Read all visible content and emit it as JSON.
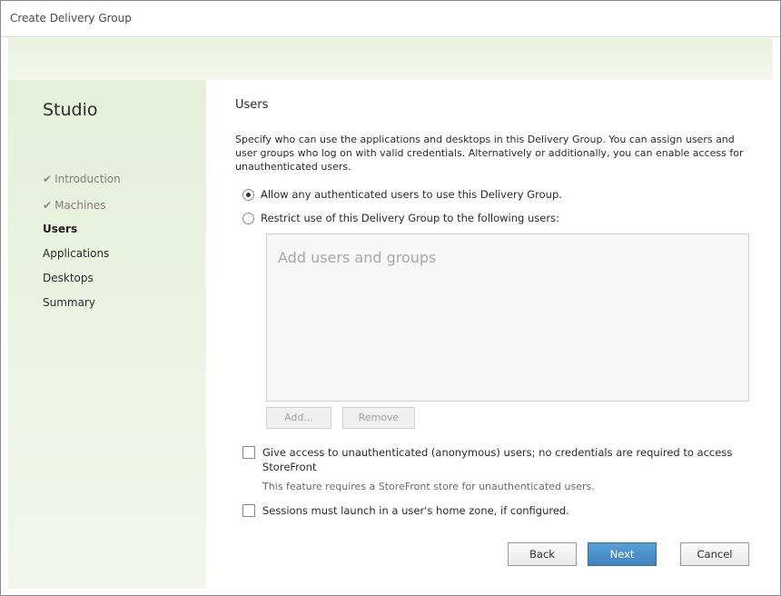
{
  "window": {
    "title": "Create Delivery Group"
  },
  "sidebar": {
    "brand": "Studio",
    "steps": [
      {
        "label": "Introduction",
        "state": "done"
      },
      {
        "label": "Machines",
        "state": "done"
      },
      {
        "label": "Users",
        "state": "active"
      },
      {
        "label": "Applications",
        "state": "pending"
      },
      {
        "label": "Desktops",
        "state": "pending"
      },
      {
        "label": "Summary",
        "state": "pending"
      }
    ]
  },
  "main": {
    "section_title": "Users",
    "description": "Specify who can use the applications and desktops in this Delivery Group. You can assign users and user groups who log on with valid credentials. Alternatively or additionally, you can enable access for unauthenticated users.",
    "radio_options": [
      {
        "label": "Allow any authenticated users to use this Delivery Group.",
        "selected": true
      },
      {
        "label": "Restrict use of this Delivery Group to the following users:",
        "selected": false
      }
    ],
    "users_box_placeholder": "Add users and groups",
    "add_button": "Add...",
    "remove_button": "Remove",
    "unauth_checkbox": {
      "label": "Give access to unauthenticated (anonymous) users; no credentials are required to access StoreFront",
      "checked": false,
      "note": "This feature requires a StoreFront store for unauthenticated users."
    },
    "home_zone_checkbox": {
      "label": "Sessions must launch in a user's home zone, if configured.",
      "checked": false
    }
  },
  "footer": {
    "back": "Back",
    "next": "Next",
    "cancel": "Cancel"
  },
  "colors": {
    "accent": "#3f82bf",
    "sidebar_bg": "#e5efd9"
  }
}
